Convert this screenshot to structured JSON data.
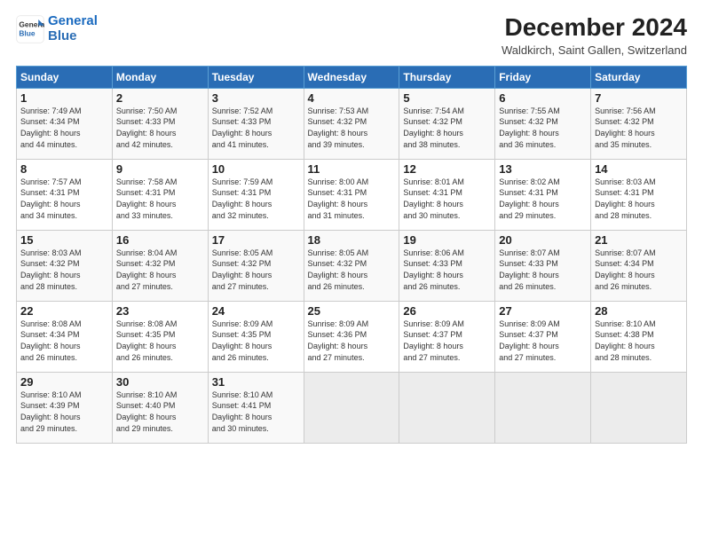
{
  "logo": {
    "line1": "General",
    "line2": "Blue"
  },
  "title": "December 2024",
  "subtitle": "Waldkirch, Saint Gallen, Switzerland",
  "days_header": [
    "Sunday",
    "Monday",
    "Tuesday",
    "Wednesday",
    "Thursday",
    "Friday",
    "Saturday"
  ],
  "weeks": [
    [
      {
        "day": "1",
        "info": "Sunrise: 7:49 AM\nSunset: 4:34 PM\nDaylight: 8 hours\nand 44 minutes."
      },
      {
        "day": "2",
        "info": "Sunrise: 7:50 AM\nSunset: 4:33 PM\nDaylight: 8 hours\nand 42 minutes."
      },
      {
        "day": "3",
        "info": "Sunrise: 7:52 AM\nSunset: 4:33 PM\nDaylight: 8 hours\nand 41 minutes."
      },
      {
        "day": "4",
        "info": "Sunrise: 7:53 AM\nSunset: 4:32 PM\nDaylight: 8 hours\nand 39 minutes."
      },
      {
        "day": "5",
        "info": "Sunrise: 7:54 AM\nSunset: 4:32 PM\nDaylight: 8 hours\nand 38 minutes."
      },
      {
        "day": "6",
        "info": "Sunrise: 7:55 AM\nSunset: 4:32 PM\nDaylight: 8 hours\nand 36 minutes."
      },
      {
        "day": "7",
        "info": "Sunrise: 7:56 AM\nSunset: 4:32 PM\nDaylight: 8 hours\nand 35 minutes."
      }
    ],
    [
      {
        "day": "8",
        "info": "Sunrise: 7:57 AM\nSunset: 4:31 PM\nDaylight: 8 hours\nand 34 minutes."
      },
      {
        "day": "9",
        "info": "Sunrise: 7:58 AM\nSunset: 4:31 PM\nDaylight: 8 hours\nand 33 minutes."
      },
      {
        "day": "10",
        "info": "Sunrise: 7:59 AM\nSunset: 4:31 PM\nDaylight: 8 hours\nand 32 minutes."
      },
      {
        "day": "11",
        "info": "Sunrise: 8:00 AM\nSunset: 4:31 PM\nDaylight: 8 hours\nand 31 minutes."
      },
      {
        "day": "12",
        "info": "Sunrise: 8:01 AM\nSunset: 4:31 PM\nDaylight: 8 hours\nand 30 minutes."
      },
      {
        "day": "13",
        "info": "Sunrise: 8:02 AM\nSunset: 4:31 PM\nDaylight: 8 hours\nand 29 minutes."
      },
      {
        "day": "14",
        "info": "Sunrise: 8:03 AM\nSunset: 4:31 PM\nDaylight: 8 hours\nand 28 minutes."
      }
    ],
    [
      {
        "day": "15",
        "info": "Sunrise: 8:03 AM\nSunset: 4:32 PM\nDaylight: 8 hours\nand 28 minutes."
      },
      {
        "day": "16",
        "info": "Sunrise: 8:04 AM\nSunset: 4:32 PM\nDaylight: 8 hours\nand 27 minutes."
      },
      {
        "day": "17",
        "info": "Sunrise: 8:05 AM\nSunset: 4:32 PM\nDaylight: 8 hours\nand 27 minutes."
      },
      {
        "day": "18",
        "info": "Sunrise: 8:05 AM\nSunset: 4:32 PM\nDaylight: 8 hours\nand 26 minutes."
      },
      {
        "day": "19",
        "info": "Sunrise: 8:06 AM\nSunset: 4:33 PM\nDaylight: 8 hours\nand 26 minutes."
      },
      {
        "day": "20",
        "info": "Sunrise: 8:07 AM\nSunset: 4:33 PM\nDaylight: 8 hours\nand 26 minutes."
      },
      {
        "day": "21",
        "info": "Sunrise: 8:07 AM\nSunset: 4:34 PM\nDaylight: 8 hours\nand 26 minutes."
      }
    ],
    [
      {
        "day": "22",
        "info": "Sunrise: 8:08 AM\nSunset: 4:34 PM\nDaylight: 8 hours\nand 26 minutes."
      },
      {
        "day": "23",
        "info": "Sunrise: 8:08 AM\nSunset: 4:35 PM\nDaylight: 8 hours\nand 26 minutes."
      },
      {
        "day": "24",
        "info": "Sunrise: 8:09 AM\nSunset: 4:35 PM\nDaylight: 8 hours\nand 26 minutes."
      },
      {
        "day": "25",
        "info": "Sunrise: 8:09 AM\nSunset: 4:36 PM\nDaylight: 8 hours\nand 27 minutes."
      },
      {
        "day": "26",
        "info": "Sunrise: 8:09 AM\nSunset: 4:37 PM\nDaylight: 8 hours\nand 27 minutes."
      },
      {
        "day": "27",
        "info": "Sunrise: 8:09 AM\nSunset: 4:37 PM\nDaylight: 8 hours\nand 27 minutes."
      },
      {
        "day": "28",
        "info": "Sunrise: 8:10 AM\nSunset: 4:38 PM\nDaylight: 8 hours\nand 28 minutes."
      }
    ],
    [
      {
        "day": "29",
        "info": "Sunrise: 8:10 AM\nSunset: 4:39 PM\nDaylight: 8 hours\nand 29 minutes."
      },
      {
        "day": "30",
        "info": "Sunrise: 8:10 AM\nSunset: 4:40 PM\nDaylight: 8 hours\nand 29 minutes."
      },
      {
        "day": "31",
        "info": "Sunrise: 8:10 AM\nSunset: 4:41 PM\nDaylight: 8 hours\nand 30 minutes."
      },
      {
        "day": "",
        "info": ""
      },
      {
        "day": "",
        "info": ""
      },
      {
        "day": "",
        "info": ""
      },
      {
        "day": "",
        "info": ""
      }
    ]
  ]
}
